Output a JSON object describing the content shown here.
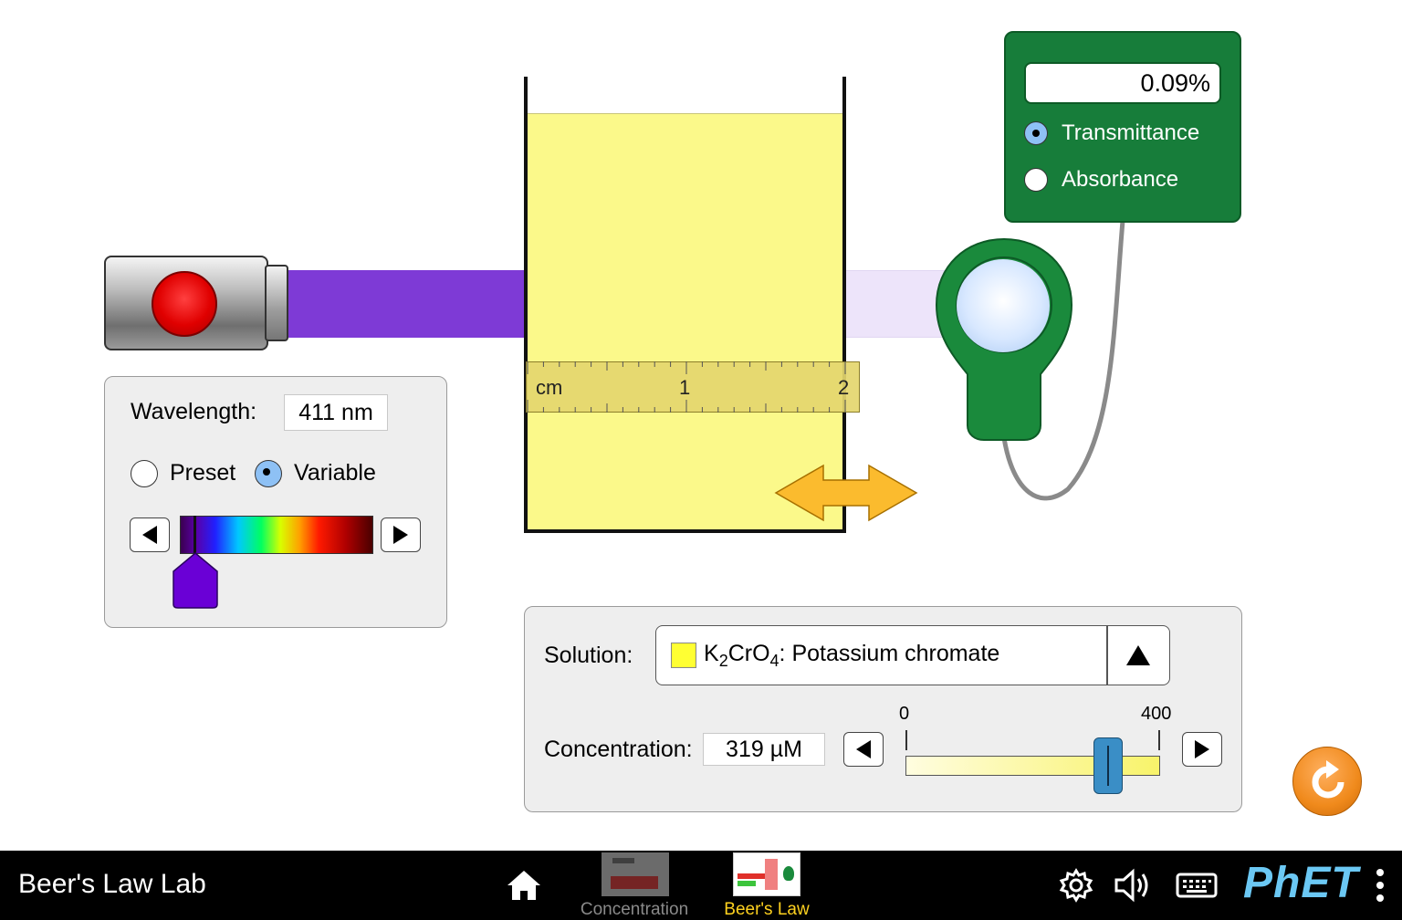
{
  "app": {
    "title": "Beer's Law Lab"
  },
  "wavelength": {
    "label": "Wavelength:",
    "value": "411 nm",
    "preset_label": "Preset",
    "variable_label": "Variable",
    "selected_mode": "Variable",
    "thumb_color": "#6a00d6"
  },
  "beam": {
    "color": "#7e3ad6"
  },
  "ruler": {
    "unit": "cm",
    "label_1": "1",
    "label_2": "2"
  },
  "detector": {
    "readout": "0.09%",
    "transmittance_label": "Transmittance",
    "absorbance_label": "Absorbance",
    "selected_mode": "Transmittance",
    "body_color": "#177d3a"
  },
  "solution_panel": {
    "solution_label": "Solution:",
    "solution_formula_prefix": "K",
    "solution_formula_sub1": "2",
    "solution_formula_mid": "CrO",
    "solution_formula_sub2": "4",
    "solution_name": ": Potassium chromate",
    "solution_swatch_color": "#ffff33",
    "concentration_label": "Concentration:",
    "concentration_value": "319 µM",
    "slider_min": "0",
    "slider_max": "400",
    "slider_value": 319
  },
  "navbar": {
    "screens": [
      {
        "label": "Concentration",
        "selected": false
      },
      {
        "label": "Beer's Law",
        "selected": true
      }
    ],
    "phet_logo": "PhET"
  },
  "icons": {
    "home": "home-icon",
    "settings": "gear-icon",
    "sound": "speaker-icon",
    "keyboard": "keyboard-icon",
    "menu": "vertical-dots-icon",
    "reset": "reset-icon"
  }
}
